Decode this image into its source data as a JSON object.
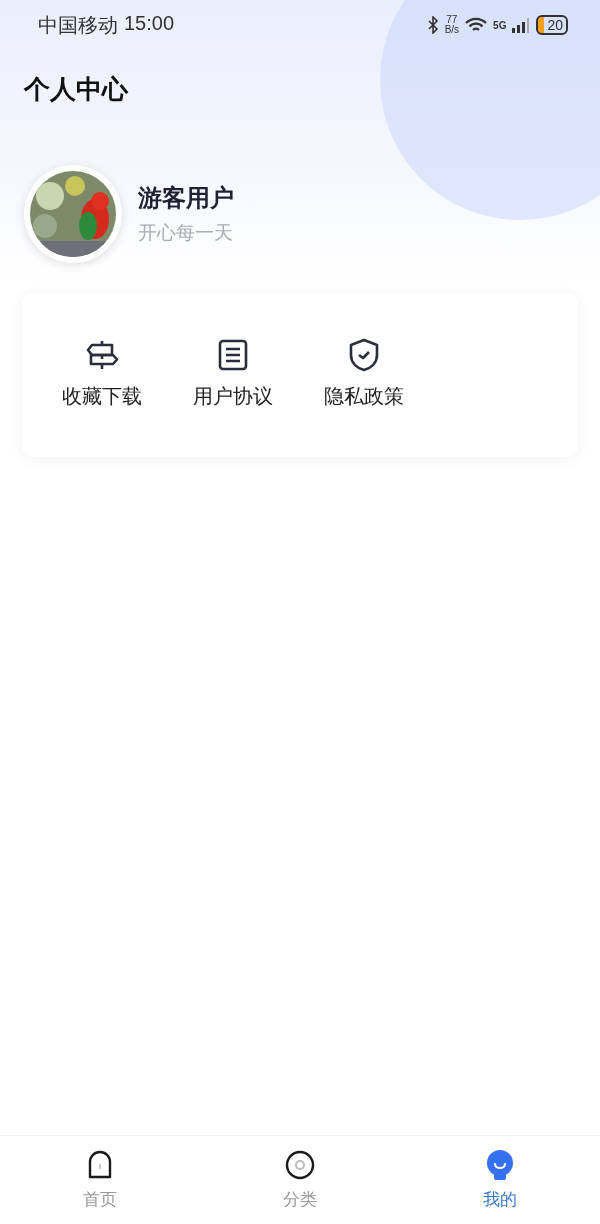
{
  "status_bar": {
    "carrier": "中国移动",
    "time": "15:00",
    "net_speed": "77",
    "net_unit": "B/s",
    "network": "5G",
    "battery": "20"
  },
  "page_title": "个人中心",
  "profile": {
    "name": "游客用户",
    "motto": "开心每一天"
  },
  "menu": [
    {
      "kind": "signpost",
      "label": "收藏下载"
    },
    {
      "kind": "document",
      "label": "用户协议"
    },
    {
      "kind": "shield",
      "label": "隐私政策"
    }
  ],
  "tab_bar": [
    {
      "kind": "home",
      "label": "首页",
      "selected": false
    },
    {
      "kind": "category",
      "label": "分类",
      "selected": false
    },
    {
      "kind": "mine",
      "label": "我的",
      "selected": true
    }
  ]
}
